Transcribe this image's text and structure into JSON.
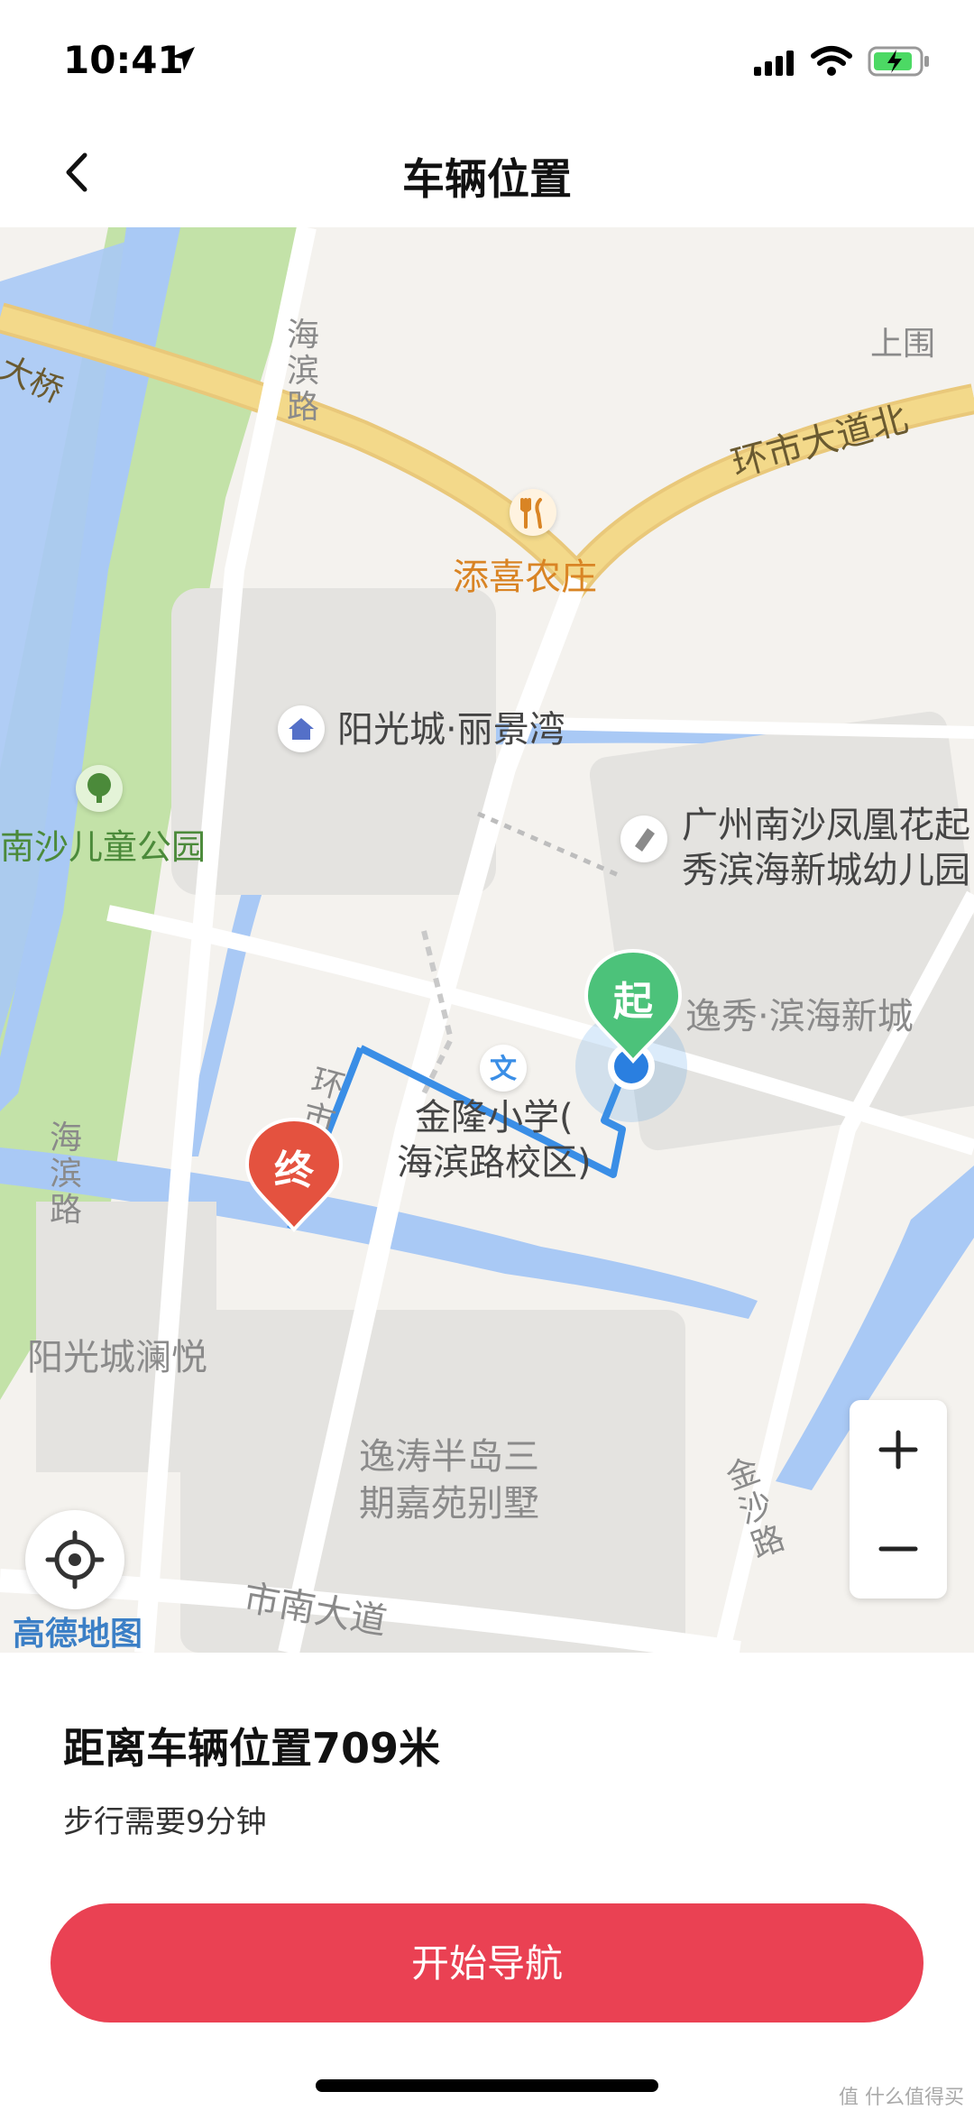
{
  "status_bar": {
    "time": "10:41"
  },
  "nav": {
    "title": "车辆位置"
  },
  "map": {
    "labels": {
      "shanghai": "上围",
      "bridge": "大桥",
      "ring_road": "环市大道北",
      "haibin_road_1": "海滨路",
      "haibin_road_2": "海滨路",
      "restaurant": "添喜农庄",
      "yangguang_lijing": "阳光城·丽景湾",
      "park": "南沙儿童公园",
      "kindergarten_line1": "广州南沙凤凰花起",
      "kindergarten_line2": "秀滨海新城幼儿园",
      "yixiu_binhai": "逸秀·滨海新城",
      "school_line1": "金隆小学(",
      "school_line2": "海滨路校区)",
      "huanshi_zhong": "环市中",
      "yangguang_lanyue": "阳光城澜悦",
      "yitao_line1": "逸涛半岛三",
      "yitao_line2": "期嘉苑别墅",
      "jinsha_road": "金沙路",
      "shinan_road": "市南大道",
      "amap_logo": "高德地图"
    },
    "start_pin": "起",
    "end_pin": "终",
    "zoom_in": "+",
    "zoom_out": "−",
    "colors": {
      "route": "#3a8ee6",
      "start_pin": "#4cc27a",
      "end_pin": "#e4523f",
      "water": "#a9c9f5",
      "park": "#c3e2a8",
      "highway": "#f3d98a"
    }
  },
  "sheet": {
    "distance": "距离车辆位置709米",
    "walk_time": "步行需要9分钟",
    "navigate_button": "开始导航"
  },
  "watermark": "值 什么值得买"
}
